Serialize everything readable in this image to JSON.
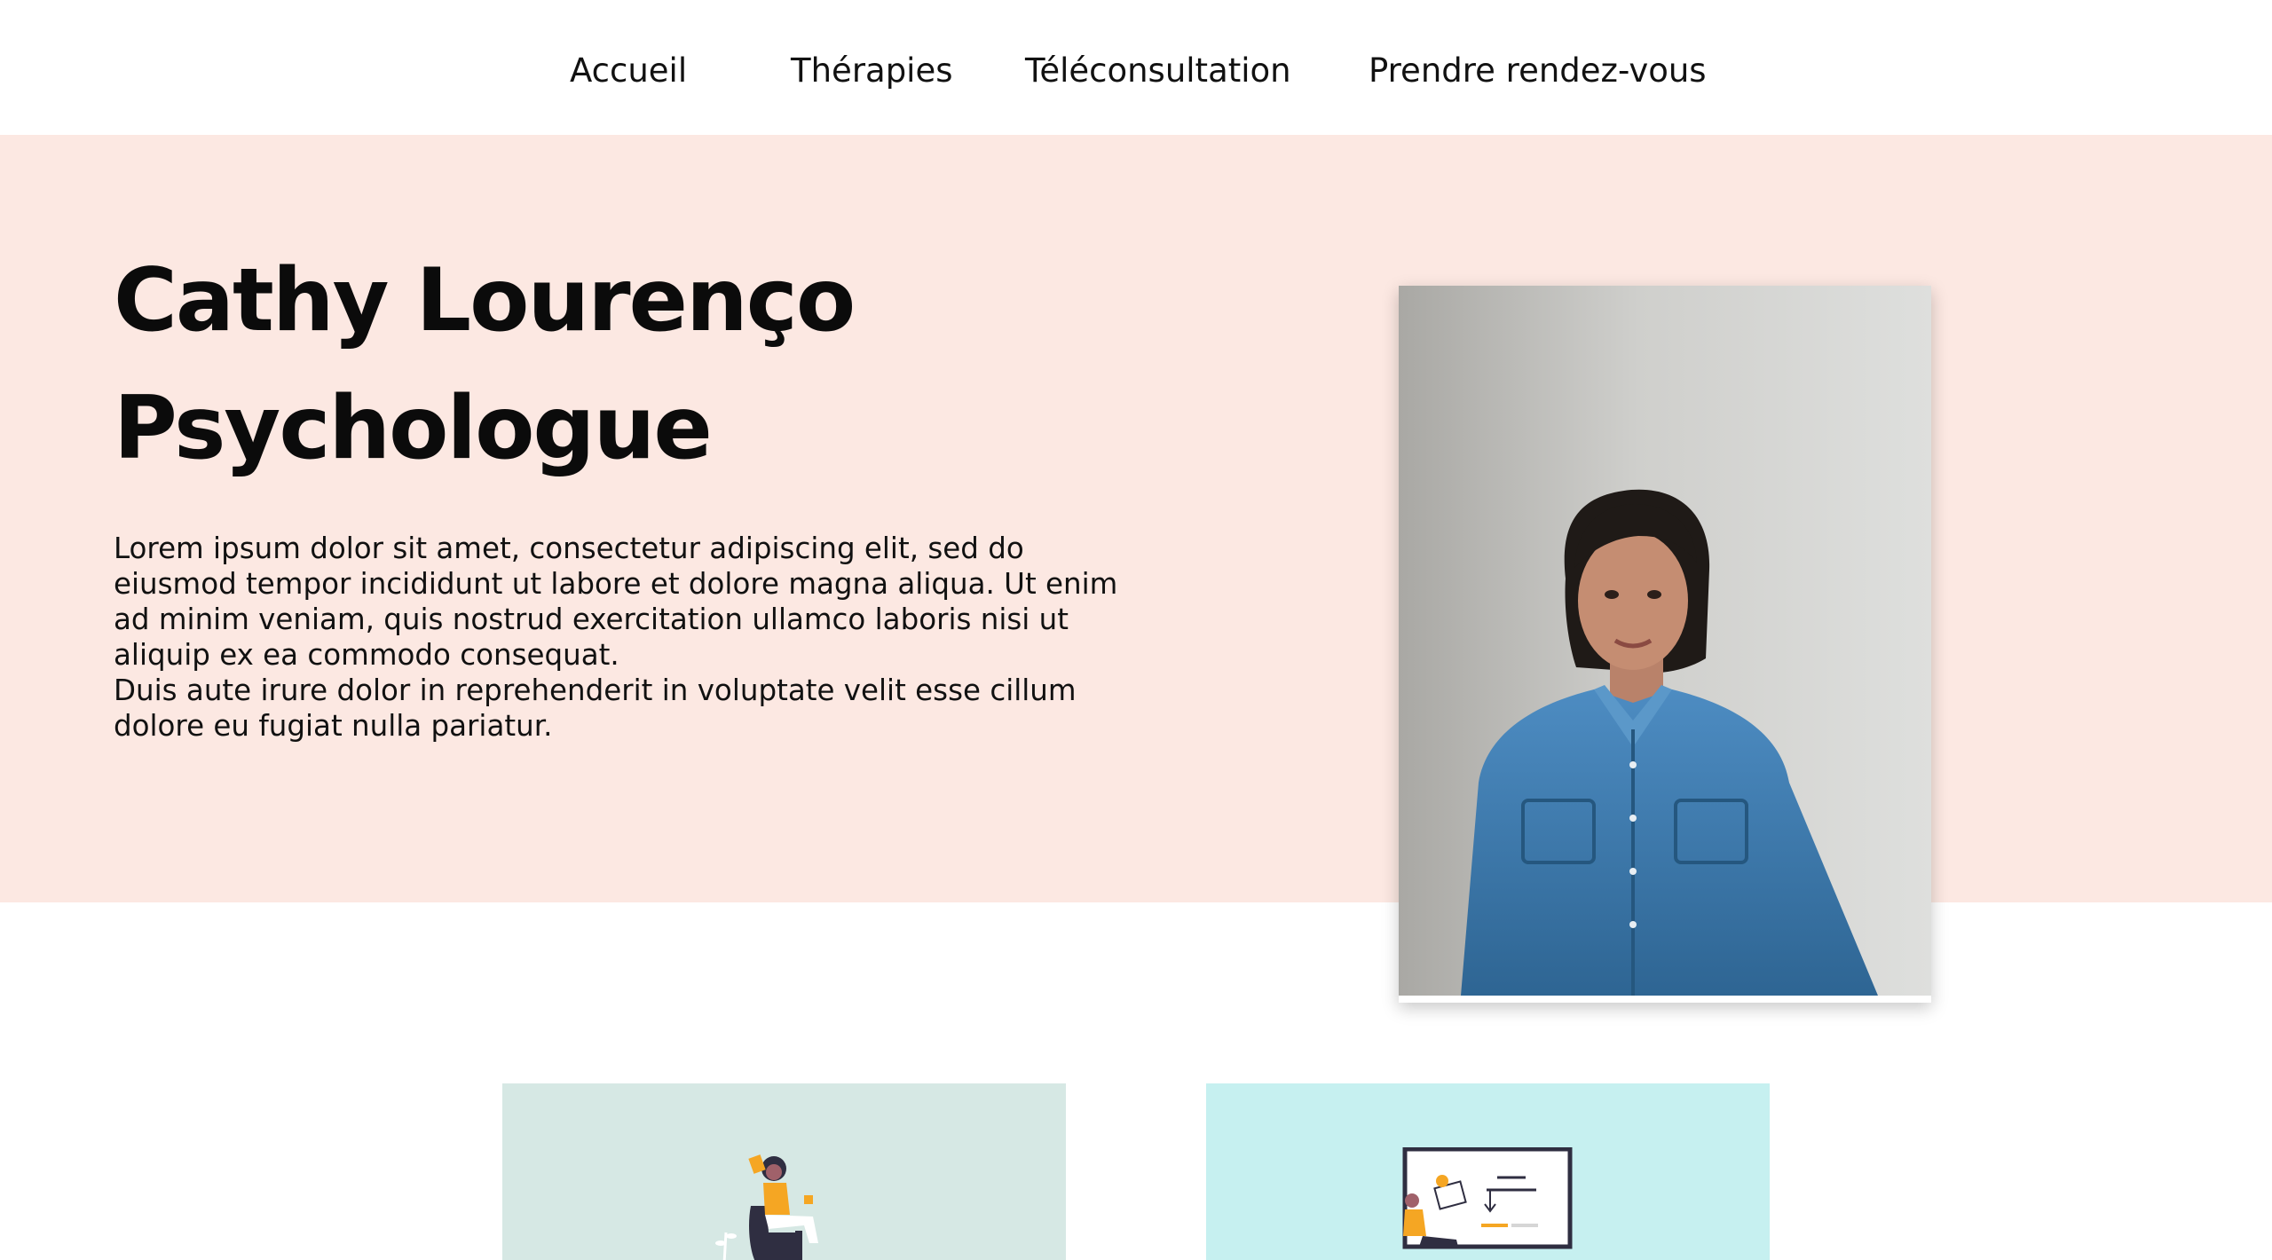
{
  "nav": {
    "items": [
      {
        "label": "Accueil"
      },
      {
        "label": "Thérapies"
      },
      {
        "label": "Téléconsultation"
      },
      {
        "label": "Prendre rendez-vous"
      }
    ]
  },
  "hero": {
    "title_line1": "Cathy Lourenço",
    "title_line2": "Psychologue",
    "paragraph1": "Lorem ipsum dolor sit amet, consectetur adipiscing elit, sed do eiusmod tempor incididunt ut labore et dolore magna aliqua. Ut enim ad minim veniam, quis nostrud exercitation ullamco laboris nisi ut aliquip ex ea commodo consequat.",
    "paragraph2": "Duis aute irure dolor in reprehenderit in voluptate velit esse cillum dolore eu fugiat nulla pariatur."
  },
  "colors": {
    "hero_background": "#fce8e2",
    "card_left_background": "#d6e8e4",
    "card_right_background": "#c6f0f0",
    "accent_yellow": "#f5a623",
    "shirt_blue": "#3f7fb5"
  },
  "icons": [
    "person-relaxing-illustration",
    "presentation-board-illustration",
    "portrait-photo"
  ]
}
